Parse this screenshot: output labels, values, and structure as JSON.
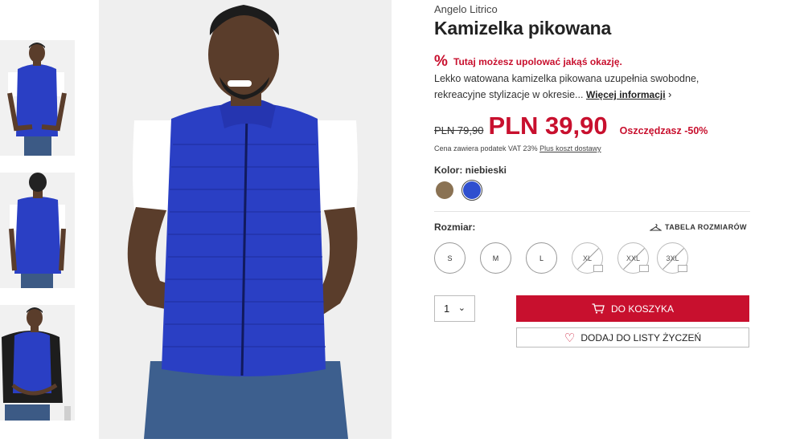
{
  "product": {
    "brand": "Angelo Litrico",
    "title": "Kamizelka pikowana",
    "deal": {
      "icon": "%",
      "text": "Tutaj możesz upolować jakąś okazję."
    },
    "description": "Lekko watowana kamizelka pikowana uzupełnia swobodne, rekreacyjne stylizacje w okresie...",
    "more_link": "Więcej informacji",
    "more_chevron": "›",
    "old_price": "PLN 79,90",
    "new_price": "PLN 39,90",
    "saving": "Oszczędzasz -50%",
    "vat_text": "Cena zawiera podatek VAT 23%",
    "shipping_link": "Plus koszt dostawy"
  },
  "color": {
    "label": "Kolor: niebieski",
    "swatches": [
      {
        "name": "brązowy",
        "hex": "#8a7253",
        "selected": false
      },
      {
        "name": "niebieski",
        "hex": "#2f4fcf",
        "selected": true
      }
    ]
  },
  "size": {
    "label": "Rozmiar:",
    "table_link": "TABELA ROZMIARÓW",
    "options": [
      {
        "label": "S",
        "available": true
      },
      {
        "label": "M",
        "available": true
      },
      {
        "label": "L",
        "available": true
      },
      {
        "label": "XL",
        "available": false
      },
      {
        "label": "XXL",
        "available": false
      },
      {
        "label": "3XL",
        "available": false
      }
    ]
  },
  "quantity": {
    "value": "1",
    "chevron": "⌄"
  },
  "actions": {
    "add_to_cart": "DO KOSZYKA",
    "add_to_wishlist": "DODAJ DO LISTY ŻYCZEŃ",
    "wishlist_icon": "♡"
  },
  "colors": {
    "accent": "#c8102e",
    "vest": "#2a3fc4"
  }
}
